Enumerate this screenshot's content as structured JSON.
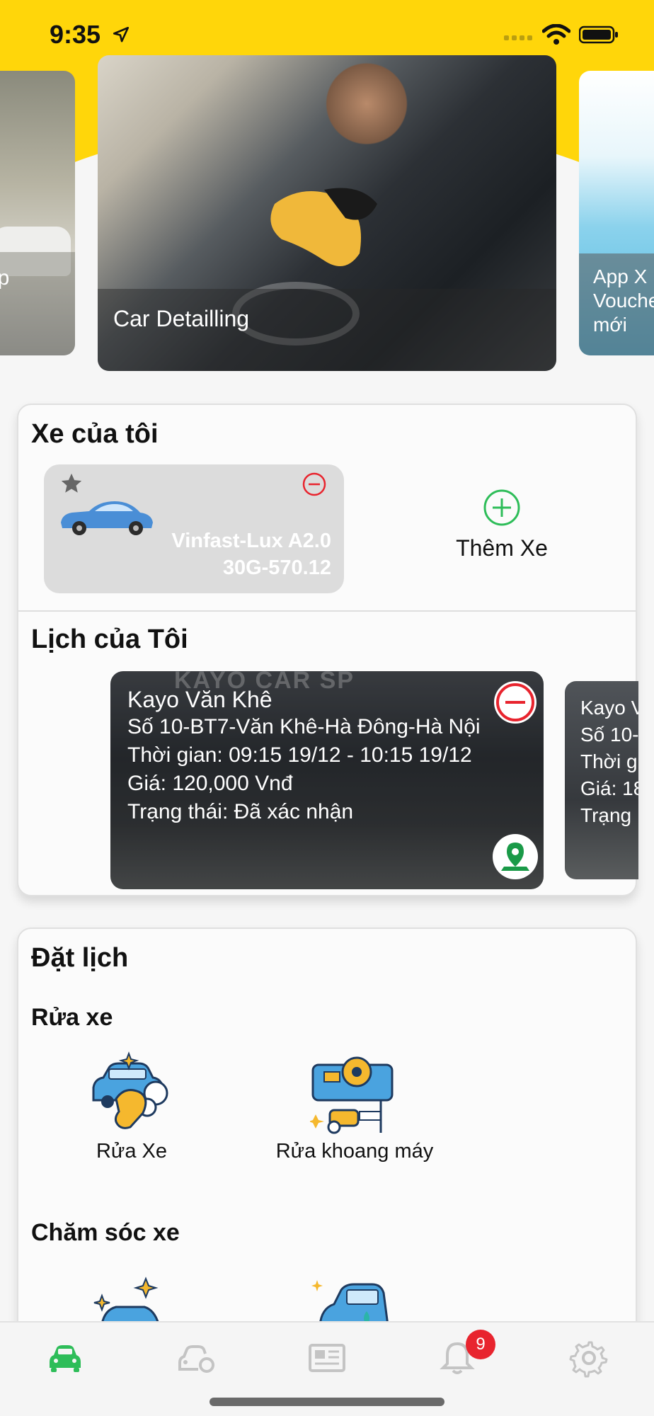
{
  "status_bar": {
    "time": "9:35"
  },
  "banners": [
    {
      "caption": "ep"
    },
    {
      "caption": "Car Detailling"
    },
    {
      "caption_line1": "App X",
      "caption_line2": "Vouche",
      "caption_line3": "mới"
    }
  ],
  "my_cars": {
    "title": "Xe của tôi",
    "car": {
      "name": "Vinfast-Lux A2.0",
      "plate": "30G-570.12",
      "icon": "blue-car-icon"
    },
    "add_label": "Thêm Xe"
  },
  "my_schedule": {
    "title": "Lịch của Tôi",
    "appointment": {
      "sign_text": "KAYO CAR SP",
      "name": "Kayo Văn Khê",
      "address": "Số 10-BT7-Văn Khê-Hà Đông-Hà Nội",
      "time": "Thời gian: 09:15 19/12 - 10:15 19/12",
      "price": "Giá: 120,000 Vnđ",
      "status": "Trạng thái: Đã xác nhận"
    },
    "peek": {
      "name": "Kayo V",
      "address": "Số 10-",
      "time": "Thời g",
      "price": "Giá: 18",
      "status": "Trạng"
    }
  },
  "booking": {
    "title": "Đặt lịch",
    "wash": {
      "title": "Rửa xe",
      "items": [
        {
          "label": "Rửa Xe",
          "icon": "car-wash-icon"
        },
        {
          "label": "Rửa khoang máy",
          "icon": "engine-wash-icon"
        }
      ]
    },
    "care": {
      "title": "Chăm sóc xe"
    }
  },
  "tab_bar": {
    "items": [
      "car-tab-icon",
      "garage-tab-icon",
      "news-tab-icon",
      "bell-tab-icon",
      "gear-tab-icon"
    ],
    "notification_count": "9",
    "active_color": "#2ebd59"
  },
  "colors": {
    "accent": "#ffd60a",
    "danger": "#e8242e",
    "success": "#2ebd59"
  }
}
